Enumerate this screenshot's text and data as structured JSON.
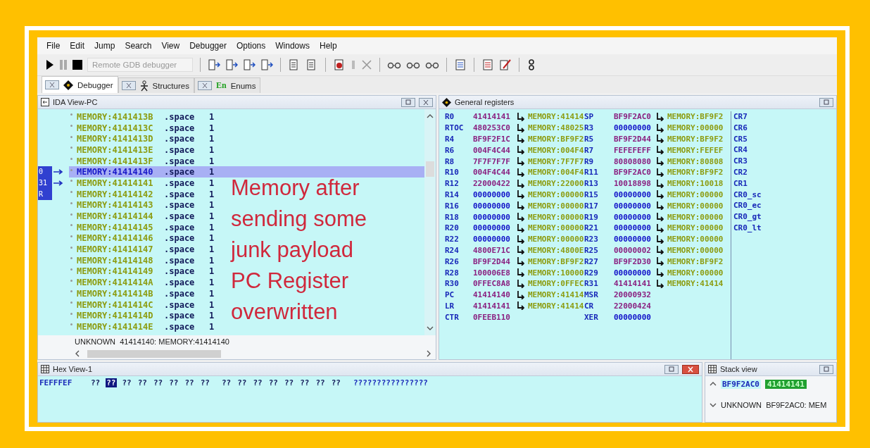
{
  "menu": [
    "File",
    "Edit",
    "Jump",
    "Search",
    "View",
    "Debugger",
    "Options",
    "Windows",
    "Help"
  ],
  "toolbar": {
    "debugger_select": "Remote GDB debugger"
  },
  "tabs": [
    {
      "label": "Debugger",
      "selected": true,
      "kind": "diamond"
    },
    {
      "label": "Structures",
      "selected": false,
      "kind": "figure"
    },
    {
      "label": "Enums",
      "selected": false,
      "kind": "text",
      "icon_text": "En"
    }
  ],
  "ida_view": {
    "title": "IDA View-PC",
    "lines": [
      {
        "address": "MEMORY:4141413B",
        "directive": ".space",
        "operand": "1",
        "current": false
      },
      {
        "address": "MEMORY:4141413C",
        "directive": ".space",
        "operand": "1",
        "current": false
      },
      {
        "address": "MEMORY:4141413D",
        "directive": ".space",
        "operand": "1",
        "current": false
      },
      {
        "address": "MEMORY:4141413E",
        "directive": ".space",
        "operand": "1",
        "current": false
      },
      {
        "address": "MEMORY:4141413F",
        "directive": ".space",
        "operand": "1",
        "current": false
      },
      {
        "address": "MEMORY:41414140",
        "directive": ".space",
        "operand": "1",
        "current": true,
        "marker": "0",
        "arrow": true
      },
      {
        "address": "MEMORY:41414141",
        "directive": ".space",
        "operand": "1",
        "current": false,
        "marker": "31",
        "arrow": true
      },
      {
        "address": "MEMORY:41414142",
        "directive": ".space",
        "operand": "1",
        "current": false,
        "marker": "R",
        "arrow": false
      },
      {
        "address": "MEMORY:41414143",
        "directive": ".space",
        "operand": "1",
        "current": false
      },
      {
        "address": "MEMORY:41414144",
        "directive": ".space",
        "operand": "1",
        "current": false
      },
      {
        "address": "MEMORY:41414145",
        "directive": ".space",
        "operand": "1",
        "current": false
      },
      {
        "address": "MEMORY:41414146",
        "directive": ".space",
        "operand": "1",
        "current": false
      },
      {
        "address": "MEMORY:41414147",
        "directive": ".space",
        "operand": "1",
        "current": false
      },
      {
        "address": "MEMORY:41414148",
        "directive": ".space",
        "operand": "1",
        "current": false
      },
      {
        "address": "MEMORY:41414149",
        "directive": ".space",
        "operand": "1",
        "current": false
      },
      {
        "address": "MEMORY:4141414A",
        "directive": ".space",
        "operand": "1",
        "current": false
      },
      {
        "address": "MEMORY:4141414B",
        "directive": ".space",
        "operand": "1",
        "current": false
      },
      {
        "address": "MEMORY:4141414C",
        "directive": ".space",
        "operand": "1",
        "current": false
      },
      {
        "address": "MEMORY:4141414D",
        "directive": ".space",
        "operand": "1",
        "current": false
      },
      {
        "address": "MEMORY:4141414E",
        "directive": ".space",
        "operand": "1",
        "current": false
      }
    ],
    "annotation_lines": [
      "Memory after",
      "sending some",
      "junk payload",
      "PC Register",
      "overwritten"
    ],
    "status": "UNKNOWN  41414140: MEMORY:41414140"
  },
  "registers": {
    "title": "General registers",
    "rows": [
      {
        "left": {
          "name": "R0",
          "value": "41414141",
          "changed": true,
          "memory": "MEMORY:41414"
        },
        "right": {
          "name": "SP",
          "value": "BF9F2AC0",
          "changed": true,
          "memory": "MEMORY:BF9F2"
        }
      },
      {
        "left": {
          "name": "RTOC",
          "value": "480253C0",
          "changed": true,
          "memory": "MEMORY:48025"
        },
        "right": {
          "name": "R3",
          "value": "00000000",
          "changed": false,
          "memory": "MEMORY:00000"
        }
      },
      {
        "left": {
          "name": "R4",
          "value": "BF9F2F1C",
          "changed": true,
          "memory": "MEMORY:BF9F2"
        },
        "right": {
          "name": "R5",
          "value": "BF9F2D44",
          "changed": true,
          "memory": "MEMORY:BF9F2"
        }
      },
      {
        "left": {
          "name": "R6",
          "value": "004F4C44",
          "changed": true,
          "memory": "MEMORY:004F4"
        },
        "right": {
          "name": "R7",
          "value": "FEFEFEFF",
          "changed": true,
          "memory": "MEMORY:FEFEF"
        }
      },
      {
        "left": {
          "name": "R8",
          "value": "7F7F7F7F",
          "changed": true,
          "memory": "MEMORY:7F7F7"
        },
        "right": {
          "name": "R9",
          "value": "80808080",
          "changed": true,
          "memory": "MEMORY:80808"
        }
      },
      {
        "left": {
          "name": "R10",
          "value": "004F4C44",
          "changed": true,
          "memory": "MEMORY:004F4"
        },
        "right": {
          "name": "R11",
          "value": "BF9F2AC0",
          "changed": true,
          "memory": "MEMORY:BF9F2"
        }
      },
      {
        "left": {
          "name": "R12",
          "value": "22000422",
          "changed": true,
          "memory": "MEMORY:22000"
        },
        "right": {
          "name": "R13",
          "value": "10018898",
          "changed": true,
          "memory": "MEMORY:10018"
        }
      },
      {
        "left": {
          "name": "R14",
          "value": "00000000",
          "changed": false,
          "memory": "MEMORY:00000"
        },
        "right": {
          "name": "R15",
          "value": "00000000",
          "changed": false,
          "memory": "MEMORY:00000"
        }
      },
      {
        "left": {
          "name": "R16",
          "value": "00000000",
          "changed": false,
          "memory": "MEMORY:00000"
        },
        "right": {
          "name": "R17",
          "value": "00000000",
          "changed": false,
          "memory": "MEMORY:00000"
        }
      },
      {
        "left": {
          "name": "R18",
          "value": "00000000",
          "changed": false,
          "memory": "MEMORY:00000"
        },
        "right": {
          "name": "R19",
          "value": "00000000",
          "changed": false,
          "memory": "MEMORY:00000"
        }
      },
      {
        "left": {
          "name": "R20",
          "value": "00000000",
          "changed": false,
          "memory": "MEMORY:00000"
        },
        "right": {
          "name": "R21",
          "value": "00000000",
          "changed": false,
          "memory": "MEMORY:00000"
        }
      },
      {
        "left": {
          "name": "R22",
          "value": "00000000",
          "changed": false,
          "memory": "MEMORY:00000"
        },
        "right": {
          "name": "R23",
          "value": "00000000",
          "changed": false,
          "memory": "MEMORY:00000"
        }
      },
      {
        "left": {
          "name": "R24",
          "value": "4800E71C",
          "changed": true,
          "memory": "MEMORY:4800E"
        },
        "right": {
          "name": "R25",
          "value": "00000002",
          "changed": true,
          "memory": "MEMORY:00000"
        }
      },
      {
        "left": {
          "name": "R26",
          "value": "BF9F2D44",
          "changed": true,
          "memory": "MEMORY:BF9F2"
        },
        "right": {
          "name": "R27",
          "value": "BF9F2D30",
          "changed": true,
          "memory": "MEMORY:BF9F2"
        }
      },
      {
        "left": {
          "name": "R28",
          "value": "100006E8",
          "changed": true,
          "memory": "MEMORY:10000"
        },
        "right": {
          "name": "R29",
          "value": "00000000",
          "changed": false,
          "memory": "MEMORY:00000"
        }
      },
      {
        "left": {
          "name": "R30",
          "value": "0FFEC8A8",
          "changed": true,
          "memory": "MEMORY:0FFEC"
        },
        "right": {
          "name": "R31",
          "value": "41414141",
          "changed": true,
          "memory": "MEMORY:41414"
        }
      },
      {
        "left": {
          "name": "PC",
          "value": "41414140",
          "changed": true,
          "memory": "MEMORY:41414"
        },
        "right": {
          "name": "MSR",
          "value": "20000932",
          "changed": true
        }
      },
      {
        "left": {
          "name": "LR",
          "value": "41414141",
          "changed": true,
          "memory": "MEMORY:41414"
        },
        "right": {
          "name": "CR",
          "value": "22000424",
          "changed": true
        }
      },
      {
        "left": {
          "name": "CTR",
          "value": "0FEEB110",
          "changed": true
        },
        "right": {
          "name": "XER",
          "value": "00000000",
          "changed": false
        }
      }
    ],
    "flags": [
      "CR7",
      "CR6",
      "CR5",
      "CR4",
      "CR3",
      "CR2",
      "CR1",
      "CR0_sc",
      "CR0_ec",
      "CR0_gt",
      "CR0_lt"
    ]
  },
  "hex_view": {
    "title": "Hex View-1",
    "address": "FEFFFEF",
    "bytes": [
      {
        "text": "??",
        "selected": false
      },
      {
        "text": "??",
        "selected": true
      },
      {
        "text": "??",
        "selected": false
      },
      {
        "text": "??",
        "selected": false
      },
      {
        "text": "??",
        "selected": false
      },
      {
        "text": "??",
        "selected": false
      },
      {
        "text": "??",
        "selected": false
      },
      {
        "text": "??",
        "selected": false
      },
      {
        "text": "??",
        "selected": false
      },
      {
        "text": "??",
        "selected": false
      },
      {
        "text": "??",
        "selected": false
      },
      {
        "text": "??",
        "selected": false
      },
      {
        "text": "??",
        "selected": false
      },
      {
        "text": "??",
        "selected": false
      },
      {
        "text": "??",
        "selected": false
      },
      {
        "text": "??",
        "selected": false
      }
    ],
    "ascii": "????????????????"
  },
  "stack_view": {
    "title": "Stack view",
    "rows": [
      {
        "address": "BF9F2AC0",
        "value": "41414141",
        "selected": true
      }
    ],
    "status": "UNKNOWN  BF9F2AC0: MEM"
  }
}
